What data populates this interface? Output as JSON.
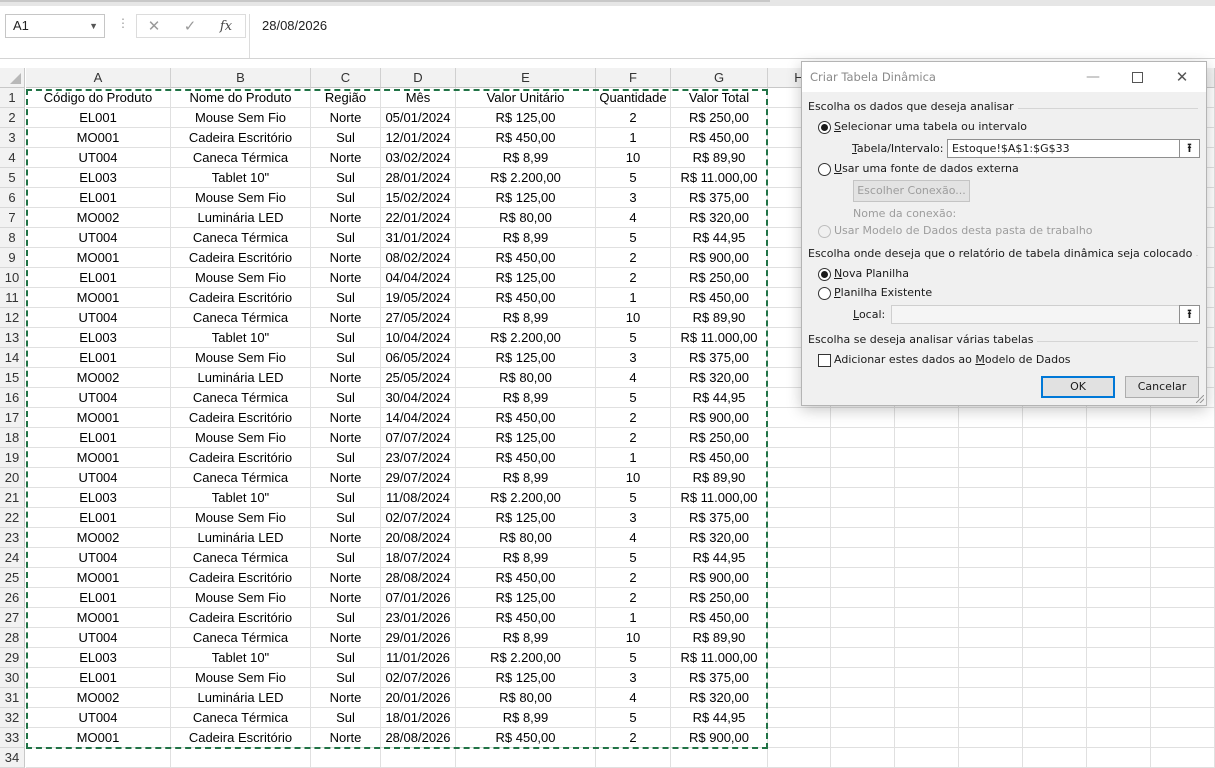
{
  "formula_bar": {
    "name_box": "A1",
    "cancel_icon": "✕",
    "enter_icon": "✓",
    "fx_label": "fx",
    "formula_value": "28/08/2026"
  },
  "columns": [
    "A",
    "B",
    "C",
    "D",
    "E",
    "F",
    "G",
    "H"
  ],
  "table": {
    "headers": [
      "Código do Produto",
      "Nome do Produto",
      "Região",
      "Mês",
      "Valor Unitário",
      "Quantidade",
      "Valor Total"
    ],
    "rows": [
      [
        "EL001",
        "Mouse Sem Fio",
        "Norte",
        "05/01/2024",
        "R$ 125,00",
        "2",
        "R$ 250,00"
      ],
      [
        "MO001",
        "Cadeira Escritório",
        "Sul",
        "12/01/2024",
        "R$ 450,00",
        "1",
        "R$ 450,00"
      ],
      [
        "UT004",
        "Caneca Térmica",
        "Norte",
        "03/02/2024",
        "R$ 8,99",
        "10",
        "R$ 89,90"
      ],
      [
        "EL003",
        "Tablet 10\"",
        "Sul",
        "28/01/2024",
        "R$ 2.200,00",
        "5",
        "R$ 11.000,00"
      ],
      [
        "EL001",
        "Mouse Sem Fio",
        "Sul",
        "15/02/2024",
        "R$ 125,00",
        "3",
        "R$ 375,00"
      ],
      [
        "MO002",
        "Luminária LED",
        "Norte",
        "22/01/2024",
        "R$ 80,00",
        "4",
        "R$ 320,00"
      ],
      [
        "UT004",
        "Caneca Térmica",
        "Sul",
        "31/01/2024",
        "R$ 8,99",
        "5",
        "R$ 44,95"
      ],
      [
        "MO001",
        "Cadeira Escritório",
        "Norte",
        "08/02/2024",
        "R$ 450,00",
        "2",
        "R$ 900,00"
      ],
      [
        "EL001",
        "Mouse Sem Fio",
        "Norte",
        "04/04/2024",
        "R$ 125,00",
        "2",
        "R$ 250,00"
      ],
      [
        "MO001",
        "Cadeira Escritório",
        "Sul",
        "19/05/2024",
        "R$ 450,00",
        "1",
        "R$ 450,00"
      ],
      [
        "UT004",
        "Caneca Térmica",
        "Norte",
        "27/05/2024",
        "R$ 8,99",
        "10",
        "R$ 89,90"
      ],
      [
        "EL003",
        "Tablet 10\"",
        "Sul",
        "10/04/2024",
        "R$ 2.200,00",
        "5",
        "R$ 11.000,00"
      ],
      [
        "EL001",
        "Mouse Sem Fio",
        "Sul",
        "06/05/2024",
        "R$ 125,00",
        "3",
        "R$ 375,00"
      ],
      [
        "MO002",
        "Luminária LED",
        "Norte",
        "25/05/2024",
        "R$ 80,00",
        "4",
        "R$ 320,00"
      ],
      [
        "UT004",
        "Caneca Térmica",
        "Sul",
        "30/04/2024",
        "R$ 8,99",
        "5",
        "R$ 44,95"
      ],
      [
        "MO001",
        "Cadeira Escritório",
        "Norte",
        "14/04/2024",
        "R$ 450,00",
        "2",
        "R$ 900,00"
      ],
      [
        "EL001",
        "Mouse Sem Fio",
        "Norte",
        "07/07/2024",
        "R$ 125,00",
        "2",
        "R$ 250,00"
      ],
      [
        "MO001",
        "Cadeira Escritório",
        "Sul",
        "23/07/2024",
        "R$ 450,00",
        "1",
        "R$ 450,00"
      ],
      [
        "UT004",
        "Caneca Térmica",
        "Norte",
        "29/07/2024",
        "R$ 8,99",
        "10",
        "R$ 89,90"
      ],
      [
        "EL003",
        "Tablet 10\"",
        "Sul",
        "11/08/2024",
        "R$ 2.200,00",
        "5",
        "R$ 11.000,00"
      ],
      [
        "EL001",
        "Mouse Sem Fio",
        "Sul",
        "02/07/2024",
        "R$ 125,00",
        "3",
        "R$ 375,00"
      ],
      [
        "MO002",
        "Luminária LED",
        "Norte",
        "20/08/2024",
        "R$ 80,00",
        "4",
        "R$ 320,00"
      ],
      [
        "UT004",
        "Caneca Térmica",
        "Sul",
        "18/07/2024",
        "R$ 8,99",
        "5",
        "R$ 44,95"
      ],
      [
        "MO001",
        "Cadeira Escritório",
        "Norte",
        "28/08/2024",
        "R$ 450,00",
        "2",
        "R$ 900,00"
      ],
      [
        "EL001",
        "Mouse Sem Fio",
        "Norte",
        "07/01/2026",
        "R$ 125,00",
        "2",
        "R$ 250,00"
      ],
      [
        "MO001",
        "Cadeira Escritório",
        "Sul",
        "23/01/2026",
        "R$ 450,00",
        "1",
        "R$ 450,00"
      ],
      [
        "UT004",
        "Caneca Térmica",
        "Norte",
        "29/01/2026",
        "R$ 8,99",
        "10",
        "R$ 89,90"
      ],
      [
        "EL003",
        "Tablet 10\"",
        "Sul",
        "11/01/2026",
        "R$ 2.200,00",
        "5",
        "R$ 11.000,00"
      ],
      [
        "EL001",
        "Mouse Sem Fio",
        "Sul",
        "02/07/2026",
        "R$ 125,00",
        "3",
        "R$ 375,00"
      ],
      [
        "MO002",
        "Luminária LED",
        "Norte",
        "20/01/2026",
        "R$ 80,00",
        "4",
        "R$ 320,00"
      ],
      [
        "UT004",
        "Caneca Térmica",
        "Sul",
        "18/01/2026",
        "R$ 8,99",
        "5",
        "R$ 44,95"
      ],
      [
        "MO001",
        "Cadeira Escritório",
        "Norte",
        "28/08/2026",
        "R$ 450,00",
        "2",
        "R$ 900,00"
      ]
    ],
    "extra_row_number": "34"
  },
  "dialog": {
    "title": "Criar Tabela Dinâmica",
    "minimize_icon": "—",
    "close_icon": "✕",
    "section1": "Escolha os dados que deseja analisar",
    "opt_table_pre": "",
    "opt_table_ul": "S",
    "opt_table_post": "elecionar uma tabela ou intervalo",
    "range_label_pre": "",
    "range_label_ul": "T",
    "range_label_post": "abela/Intervalo:",
    "range_value": "Estoque!$A$1:$G$33",
    "opt_external_pre": "",
    "opt_external_ul": "U",
    "opt_external_post": "sar uma fonte de dados externa",
    "choose_connection": "Escolher Conexão...",
    "connection_name_label": "Nome da conexão:",
    "opt_datamodel": "Usar Modelo de Dados desta pasta de trabalho",
    "section2": "Escolha onde deseja que o relatório de tabela dinâmica seja colocado",
    "opt_new_pre": "",
    "opt_new_ul": "N",
    "opt_new_post": "ova Planilha",
    "opt_existing_pre": "",
    "opt_existing_ul": "P",
    "opt_existing_post": "lanilha Existente",
    "local_label_pre": "",
    "local_label_ul": "L",
    "local_label_post": "ocal:",
    "local_value": "",
    "section3": "Escolha se deseja analisar várias tabelas",
    "add_model_pre": "Adicionar estes dados ao ",
    "add_model_ul": "M",
    "add_model_post": "odelo de Dados",
    "ok": "OK",
    "cancel": "Cancelar",
    "range_button_icon": "⭱",
    "range_icon_name": "collapse-dialog-icon"
  },
  "colors": {
    "marquee": "#217346",
    "dialog_bg": "#f0f0f0",
    "ok_border": "#0078d7",
    "header_bg": "#f2f2f2"
  }
}
